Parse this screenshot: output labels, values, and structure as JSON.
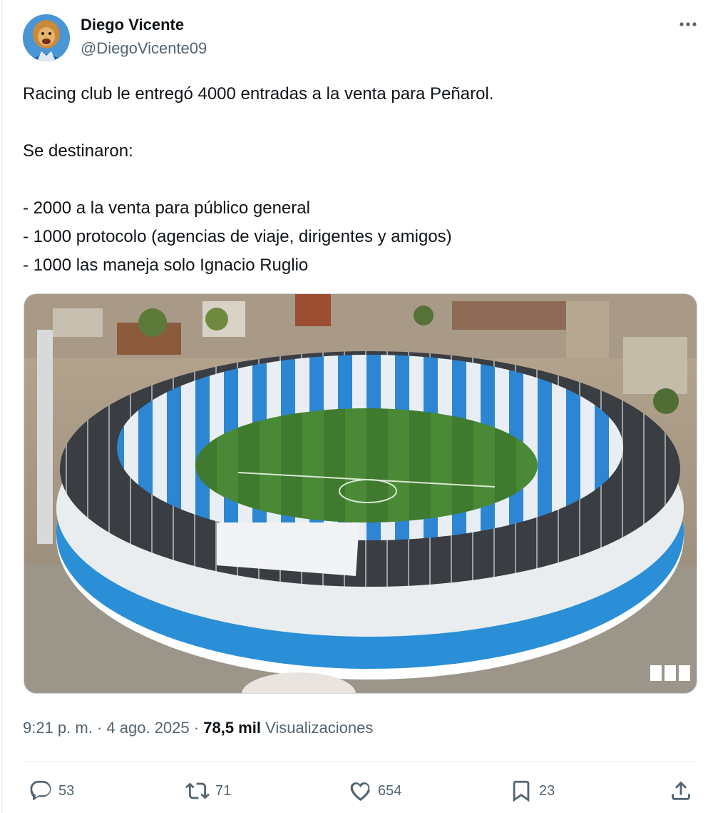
{
  "author": {
    "name": "Diego Vicente",
    "handle": "@DiegoVicente09",
    "avatar_icon": "avatar-lion-icon"
  },
  "tweet": {
    "lines": [
      "Racing club le entregó 4000 entradas a la venta para Peñarol.",
      "",
      "Se destinaron:",
      "",
      "- 2000 a la venta para público general",
      "- 1000 protocolo (agencias de viaje, dirigentes y amigos)",
      "- 1000 las maneja solo Ignacio Ruglio"
    ]
  },
  "meta": {
    "time": "9:21 p. m.",
    "dot1": "·",
    "date": "4 ago. 2025",
    "dot2": "·",
    "views_count": "78,5 mil",
    "views_label": "Visualizaciones"
  },
  "actions": {
    "replies": "53",
    "reposts": "71",
    "likes": "654",
    "bookmarks": "23"
  },
  "colors": {
    "text": "#0f1419",
    "secondary": "#536471",
    "stadium_blue": "#2a8fd6",
    "pitch_green": "#3f7a2e"
  }
}
